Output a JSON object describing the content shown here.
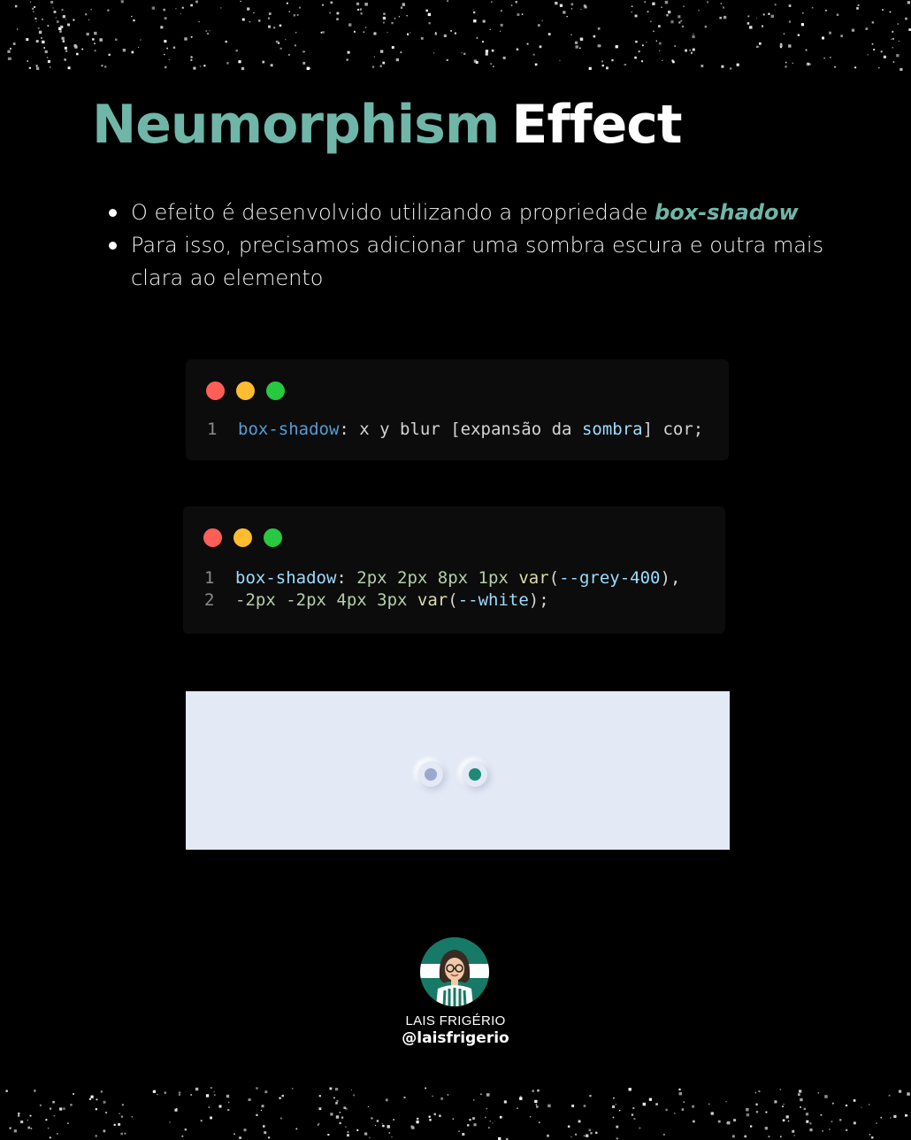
{
  "title": {
    "part1": "Neumorphism",
    "part2": "Effect"
  },
  "bullets": [
    {
      "text": "O efeito é desenvolvido utilizando a propriedade ",
      "keyword": "box-shadow"
    },
    {
      "text": "Para isso, precisamos adicionar uma sombra escura e outra mais clara ao elemento"
    }
  ],
  "code_window_1": {
    "lines": [
      {
        "num": "1",
        "tokens": [
          "box-shadow",
          ": x y blur [expansão da ",
          "sombra",
          "] cor;"
        ]
      }
    ]
  },
  "code_window_2": {
    "lines": [
      {
        "num": "1",
        "tokens": [
          "box-shadow",
          ": ",
          "2px 2px 8px 1px",
          " ",
          "var",
          "(",
          "--grey-400",
          "),"
        ]
      },
      {
        "num": "2",
        "tokens": [
          "-2px -2px 4px 3px",
          " ",
          "var",
          "(",
          "--white",
          ");"
        ]
      }
    ]
  },
  "colors": {
    "accent": "#6fb6a8",
    "preview_background": "#e3e9f5",
    "dot_red": "#ff5f57",
    "dot_yellow": "#febc2e",
    "dot_green": "#28c840"
  },
  "author": {
    "name": "LAIS FRIGÉRIO",
    "handle": "@laisfrigerio"
  }
}
